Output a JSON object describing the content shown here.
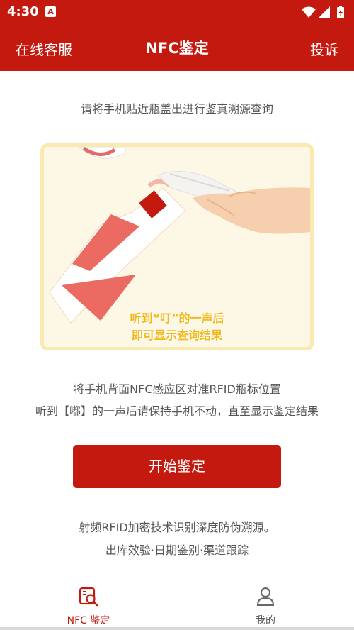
{
  "status_bar": {
    "time": "4:30",
    "notification_letter": "A",
    "icons": [
      "wifi-icon",
      "signal-icon",
      "battery-icon"
    ]
  },
  "header": {
    "left_label": "在线客服",
    "title": "NFC鉴定",
    "right_label": "投诉"
  },
  "instruction": "请将手机贴近瓶盖出进行鉴真溯源查询",
  "illustration": {
    "line1": "听到“叮”的一声后",
    "line2": "即可显示查询结果"
  },
  "description": {
    "line1": "将手机背面NFC感应区对准RFID瓶标位置",
    "line2": "听到【嘟】的一声后请保持手机不动，直至显示鉴定结果"
  },
  "start_button": "开始鉴定",
  "footer": {
    "line1": "射频RFID加密技术识别深度防伪溯源。",
    "line2": "出库效验·日期鉴别·渠道跟踪"
  },
  "tabs": [
    {
      "label": "NFC 鉴定",
      "icon": "nfc-scan-icon",
      "active": true
    },
    {
      "label": "我的",
      "icon": "person-icon",
      "active": false
    }
  ],
  "colors": {
    "primary": "#c4190e",
    "illustration_border": "#faeab1",
    "illustration_text": "#f3b716"
  }
}
